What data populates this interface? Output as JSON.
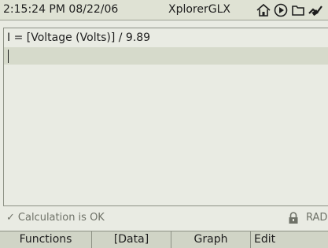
{
  "status_bar": {
    "time": "2:15:24 PM",
    "date": "08/22/06",
    "app_title": "XplorerGLX",
    "icons": [
      "home-icon",
      "play-icon",
      "folder-icon",
      "power-plug-icon"
    ]
  },
  "editor": {
    "formula_line": "I = [Voltage (Volts)] / 9.89",
    "current_line": ""
  },
  "message_bar": {
    "status_text": "Calculation is OK",
    "status_icon": "checkmark-icon",
    "angle_mode": "RAD",
    "lock_icon": "lock-icon"
  },
  "softkeys": {
    "f1": "Functions",
    "f2": "[Data]",
    "f3": "Graph",
    "f4": "Edit"
  },
  "colors": {
    "screen_bg": "#e9ebe3",
    "highlight_line": "#d6dacb",
    "text": "#1e1e1e",
    "muted_text": "#6f7268"
  }
}
